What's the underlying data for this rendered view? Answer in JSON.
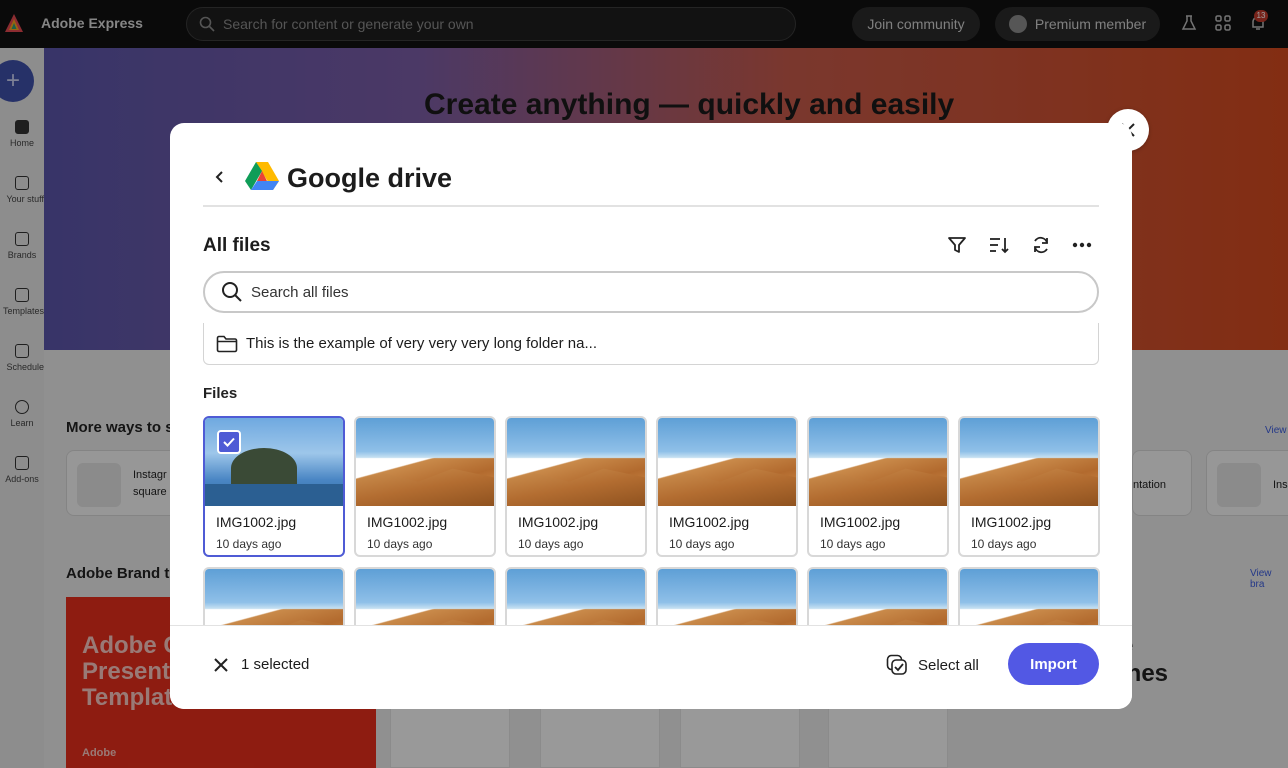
{
  "app": {
    "title": "Adobe Express",
    "search_placeholder": "Search for content or generate your own",
    "join_community": "Join community",
    "premium_member": "Premium member",
    "notification_count": "13"
  },
  "sidebar": {
    "items": [
      {
        "label": "Home"
      },
      {
        "label": "Your stuff"
      },
      {
        "label": "Brands"
      },
      {
        "label": "Templates"
      },
      {
        "label": "Schedule"
      },
      {
        "label": "Learn"
      },
      {
        "label": "Add-ons"
      }
    ]
  },
  "background": {
    "hero_title": "Create anything — quickly and easily",
    "more_ways": "More ways to st",
    "view_all_1": "View",
    "card1_line1": "Instagr",
    "card1_line2": "square",
    "card2_text": "ntation",
    "card3_text": "Ins",
    "brand_templates": "Adobe Brand te",
    "view_brand": "View bra",
    "red_card_lines": "Adobe C\nPresent\nTemplat",
    "red_card_small": "Adobe",
    "right_text": "e\nines"
  },
  "modal": {
    "title": "Google drive",
    "section_title": "All files",
    "search_placeholder": "Search all files",
    "folder_name": "This is the example of very very very long folder na...",
    "files_label": "Files",
    "files": [
      {
        "name": "IMG1002.jpg",
        "date": "10 days ago",
        "selected": true,
        "thumb": "coast"
      },
      {
        "name": "IMG1002.jpg",
        "date": "10 days ago",
        "selected": false,
        "thumb": "desert"
      },
      {
        "name": "IMG1002.jpg",
        "date": "10 days ago",
        "selected": false,
        "thumb": "desert"
      },
      {
        "name": "IMG1002.jpg",
        "date": "10 days ago",
        "selected": false,
        "thumb": "desert"
      },
      {
        "name": "IMG1002.jpg",
        "date": "10 days ago",
        "selected": false,
        "thumb": "desert"
      },
      {
        "name": "IMG1002.jpg",
        "date": "10 days ago",
        "selected": false,
        "thumb": "desert"
      },
      {
        "name": "",
        "date": "",
        "selected": false,
        "thumb": "desert"
      },
      {
        "name": "",
        "date": "",
        "selected": false,
        "thumb": "desert"
      },
      {
        "name": "",
        "date": "",
        "selected": false,
        "thumb": "desert"
      },
      {
        "name": "",
        "date": "",
        "selected": false,
        "thumb": "desert"
      },
      {
        "name": "",
        "date": "",
        "selected": false,
        "thumb": "desert"
      },
      {
        "name": "",
        "date": "",
        "selected": false,
        "thumb": "desert"
      }
    ],
    "selected_count": "1 selected",
    "select_all": "Select all",
    "import": "Import"
  },
  "colors": {
    "accent": "#5258e4",
    "selection_border": "#4f5bd5"
  },
  "icons": {
    "back": "chevron-left-icon",
    "filter": "filter-icon",
    "sort": "sort-icon",
    "refresh": "refresh-icon",
    "more": "more-icon",
    "search": "search-icon",
    "folder": "folder-icon",
    "close": "close-icon",
    "select_all": "select-all-icon"
  }
}
